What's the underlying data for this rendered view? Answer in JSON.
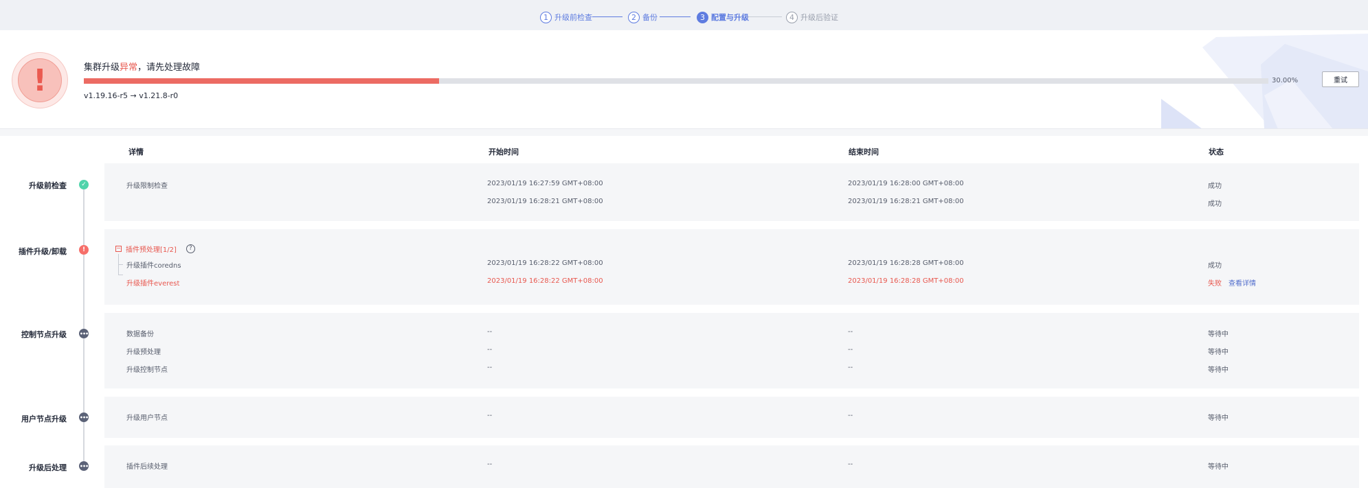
{
  "stepper": {
    "steps": [
      {
        "num": "1",
        "label": "升级前检查",
        "state": "done"
      },
      {
        "num": "2",
        "label": "备份",
        "state": "done"
      },
      {
        "num": "3",
        "label": "配置与升级",
        "state": "current"
      },
      {
        "num": "4",
        "label": "升级后验证",
        "state": "todo"
      }
    ]
  },
  "status": {
    "title_prefix": "集群升级",
    "title_error": "异常",
    "title_suffix": "，请先处理故障",
    "alert_glyph": "!",
    "progress_fraction": 0.3,
    "progress_text": "30.00%",
    "version": "v1.19.16-r5 → v1.21.8-r0",
    "retry_label": "重试",
    "colors": {
      "error": "#e8574e",
      "accent": "#5e7ce0",
      "success": "#50d4ab"
    }
  },
  "table": {
    "columns": [
      "详情",
      "开始时间",
      "结束时间",
      "状态"
    ]
  },
  "stages": [
    {
      "label": "升级前检查",
      "state": "success",
      "icon": "check-icon",
      "rows": [
        {
          "name": "升级限制检查",
          "start": "2023/01/19 16:27:59 GMT+08:00",
          "end": "2023/01/19 16:28:00 GMT+08:00",
          "status": "成功"
        },
        {
          "name": "",
          "start": "2023/01/19 16:28:21 GMT+08:00",
          "end": "2023/01/19 16:28:21 GMT+08:00",
          "status": "成功"
        }
      ]
    },
    {
      "label": "插件升级/卸载",
      "state": "error",
      "icon": "exclamation-icon",
      "group": {
        "label": "插件预处理[1/2]",
        "collapse_glyph": "−",
        "help_glyph": "?"
      },
      "rows": [
        {
          "name": "升级插件coredns",
          "start": "2023/01/19 16:28:22 GMT+08:00",
          "end": "2023/01/19 16:28:28 GMT+08:00",
          "status": "成功"
        },
        {
          "name": "升级插件everest",
          "start": "2023/01/19 16:28:22 GMT+08:00",
          "end": "2023/01/19 16:28:28 GMT+08:00",
          "status": "失败",
          "link": "查看详情"
        }
      ]
    },
    {
      "label": "控制节点升级",
      "state": "pending",
      "icon": "ellipsis-icon",
      "rows": [
        {
          "name": "数据备份",
          "start": "--",
          "end": "--",
          "status": "等待中"
        },
        {
          "name": "升级预处理",
          "start": "--",
          "end": "--",
          "status": "等待中"
        },
        {
          "name": "升级控制节点",
          "start": "--",
          "end": "--",
          "status": "等待中"
        }
      ]
    },
    {
      "label": "用户节点升级",
      "state": "pending",
      "icon": "ellipsis-icon",
      "rows": [
        {
          "name": "升级用户节点",
          "start": "--",
          "end": "--",
          "status": "等待中"
        }
      ]
    },
    {
      "label": "升级后处理",
      "state": "pending",
      "icon": "ellipsis-icon",
      "rows": [
        {
          "name": "插件后续处理",
          "start": "--",
          "end": "--",
          "status": "等待中"
        }
      ]
    }
  ],
  "glyphs": {
    "check": "✓",
    "exclamation": "!",
    "ellipsis": "•••"
  }
}
